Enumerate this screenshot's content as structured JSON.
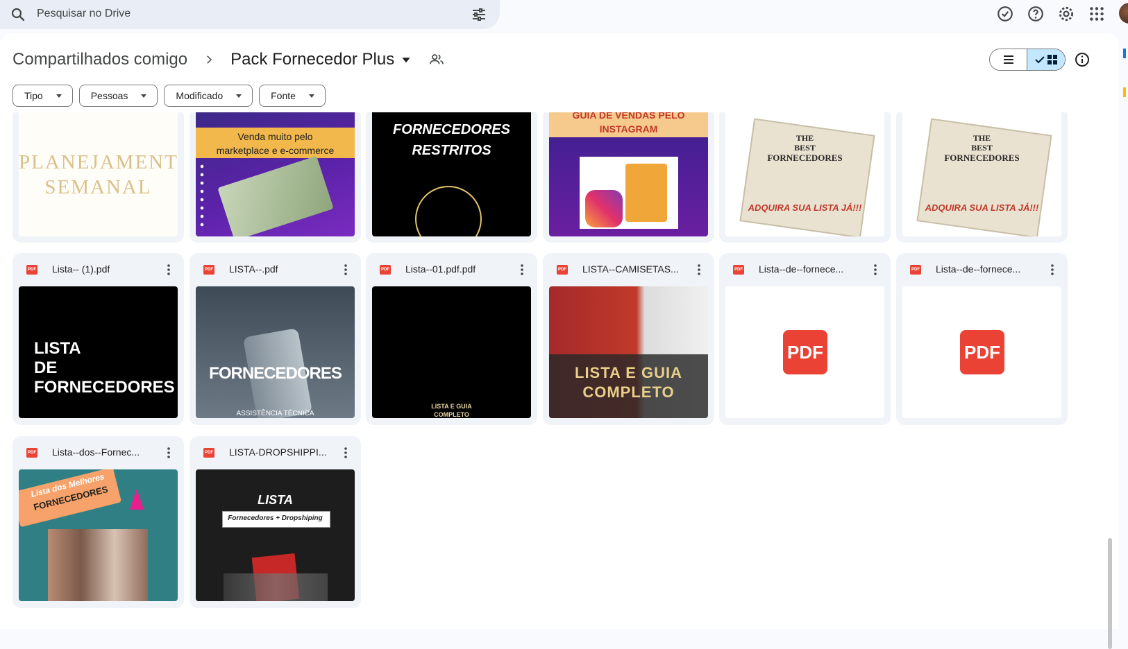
{
  "search": {
    "placeholder": "Pesquisar no Drive"
  },
  "header": {
    "root": "Compartilhados comigo",
    "current": "Pack Fornecedor Plus"
  },
  "filters": [
    "Tipo",
    "Pessoas",
    "Modificado",
    "Fonte"
  ],
  "row1_thumbs": [
    {
      "lines": [
        "PLANEJAMENTO",
        "SEMANAL"
      ]
    },
    {
      "lines": [
        "Venda muito pelo",
        "marketplace e e-commerce"
      ]
    },
    {
      "lines": [
        "FORNECEDORES",
        "RESTRITOS"
      ]
    },
    {
      "lines": [
        "GUIA DE VENDAS PELO",
        "INSTAGRAM"
      ]
    },
    {
      "lines": [
        "THE",
        "BEST",
        "FORNECEDORES",
        "ADQUIRA SUA LISTA JÁ!!!"
      ]
    },
    {
      "lines": [
        "THE",
        "BEST",
        "FORNECEDORES",
        "ADQUIRA SUA LISTA JÁ!!!"
      ]
    }
  ],
  "files": [
    {
      "name": "Lista-- (1).pdf",
      "thumb_text": [
        "LISTA",
        "DE",
        "FORNECEDORES"
      ]
    },
    {
      "name": "LISTA--.pdf",
      "thumb_text": [
        "FORNECEDORES",
        "ASSISTÊNCIA TÉCNICA"
      ]
    },
    {
      "name": "Lista--01.pdf.pdf",
      "thumb_text": [
        "LISTA E GUIA",
        "COMPLETO"
      ]
    },
    {
      "name": "LISTA--CAMISETAS...",
      "thumb_text": [
        "LISTA E GUIA",
        "COMPLETO"
      ]
    },
    {
      "name": "Lista--de--fornece...",
      "thumb_text": [
        "PDF"
      ]
    },
    {
      "name": "Lista--de--fornece...",
      "thumb_text": [
        "PDF"
      ]
    },
    {
      "name": "Lista--dos--Fornec...",
      "thumb_text": [
        "Lista dos Melhores",
        "FORNECEDORES"
      ]
    },
    {
      "name": "LISTA-DROPSHIPPI...",
      "thumb_text": [
        "LISTA",
        "Fornecedores + Dropshiping"
      ]
    }
  ],
  "pdf_badge": "PDF",
  "colors": {
    "accent": "#c2e7ff",
    "pdf_red": "#ea4335",
    "surface": "#f0f4f9"
  },
  "icons": [
    "search-icon",
    "tune-icon",
    "offline-check-icon",
    "help-icon",
    "settings-icon",
    "apps-icon",
    "shared-people-icon",
    "list-view-icon",
    "grid-view-icon",
    "info-icon",
    "more-vert-icon"
  ]
}
